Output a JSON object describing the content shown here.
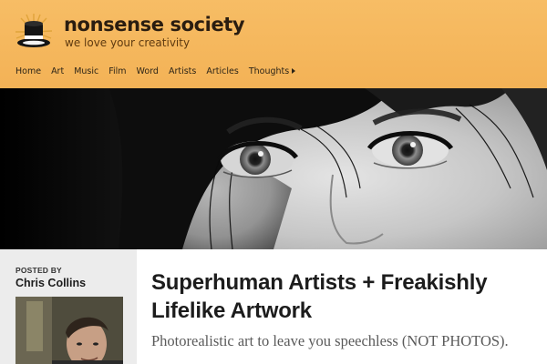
{
  "header": {
    "brand_name": "nonsense society",
    "tagline": "we love your creativity",
    "logo_icon": "top-hat-icon",
    "background_color": "#f5b65b"
  },
  "nav": {
    "items": [
      {
        "label": "Home"
      },
      {
        "label": "Art"
      },
      {
        "label": "Music"
      },
      {
        "label": "Film"
      },
      {
        "label": "Word"
      },
      {
        "label": "Artists"
      },
      {
        "label": "Articles"
      },
      {
        "label": "Thoughts",
        "has_submenu": true,
        "icon": "triangle-right-icon"
      }
    ]
  },
  "hero": {
    "image": "photorealistic-portrait-eyes"
  },
  "post": {
    "posted_by_label": "POSTED BY",
    "author": "Chris Collins",
    "title": "Superhuman Artists + Freakishly Lifelike Artwork",
    "subtitle": "Photorealistic art to leave you speechless (NOT PHOTOS)."
  }
}
